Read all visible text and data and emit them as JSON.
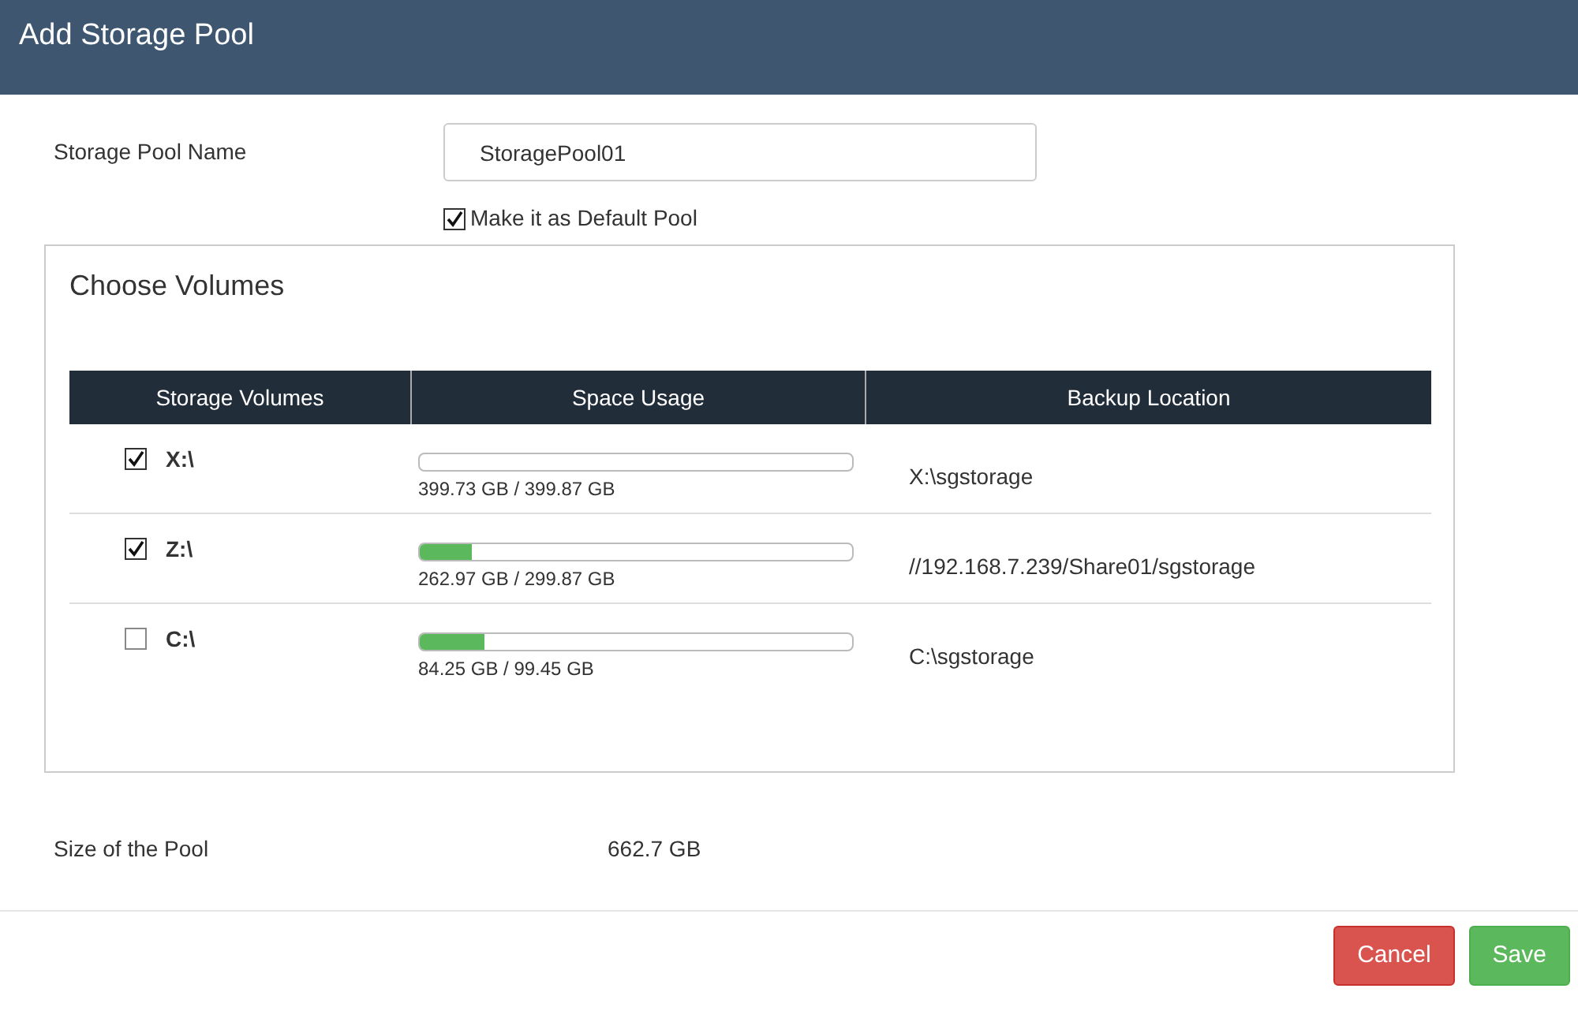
{
  "window": {
    "title": "Add Storage Pool"
  },
  "pool_name": {
    "label": "Storage Pool Name",
    "value": "StoragePool01"
  },
  "default_pool": {
    "label": "Make it as Default Pool",
    "checked": true
  },
  "volumes_panel": {
    "title": "Choose Volumes",
    "table": {
      "columns": [
        "Storage Volumes",
        "Space Usage",
        "Backup Location"
      ],
      "rows": [
        {
          "volume": "X:\\",
          "checked": true,
          "level": 0,
          "usage": "399.73 GB / 399.87 GB",
          "location": "X:\\sgstorage"
        },
        {
          "volume": "Z:\\",
          "checked": true,
          "level": 0.12,
          "usage": "262.97 GB / 299.87 GB",
          "location": "//192.168.7.239/Share01/sgstorage"
        },
        {
          "volume": "C:\\",
          "checked": false,
          "level": 0.15,
          "usage": "84.25 GB / 99.45 GB",
          "location": "C:\\sgstorage"
        }
      ]
    }
  },
  "pool_size": {
    "label": "Size of the Pool",
    "value": "662.7 GB"
  },
  "buttons": [
    {
      "label": "Cancel",
      "kind": "danger"
    },
    {
      "label": "Save",
      "kind": "success"
    }
  ]
}
